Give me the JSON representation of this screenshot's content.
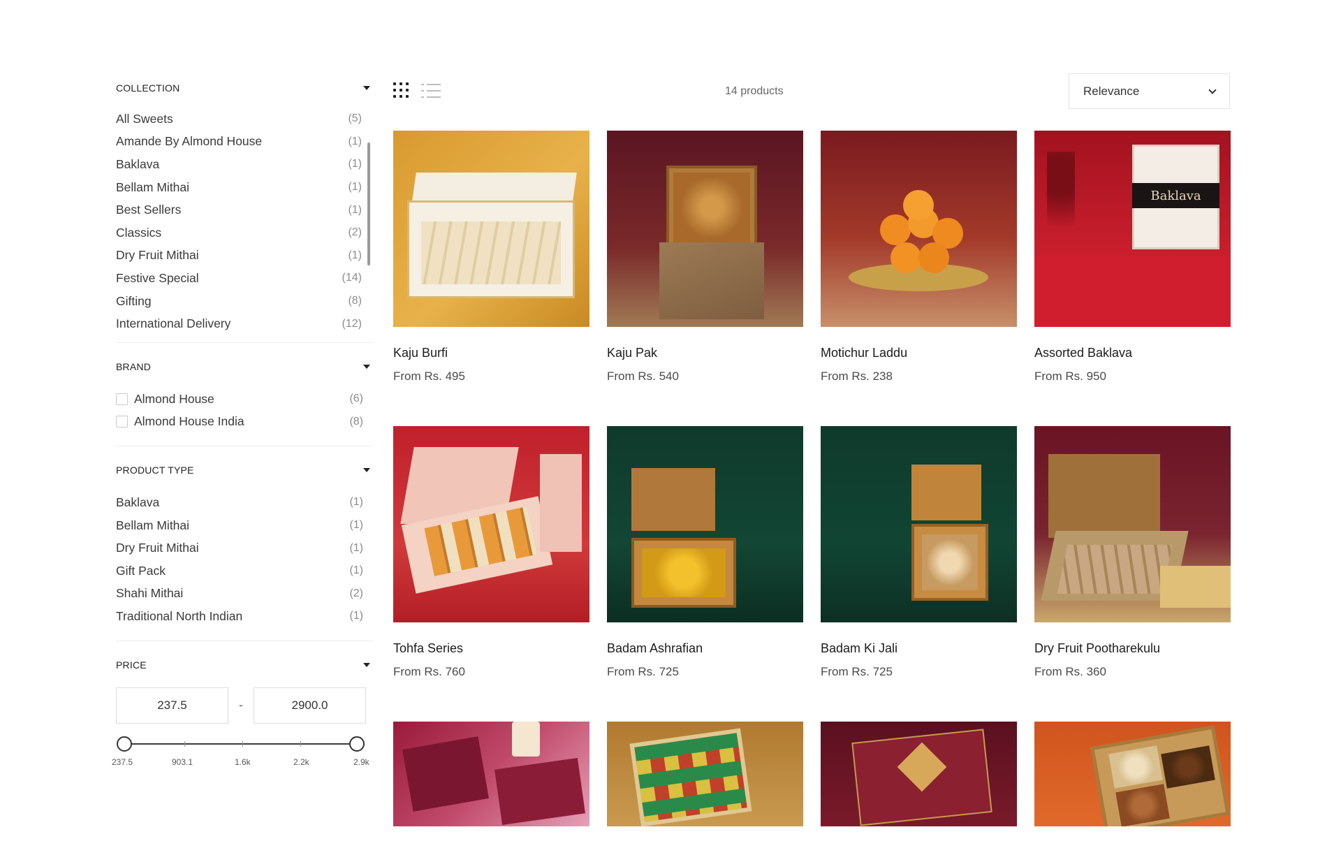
{
  "sidebar": {
    "collection": {
      "title": "COLLECTION",
      "items": [
        {
          "label": "All Sweets",
          "count": "(5)"
        },
        {
          "label": "Amande By Almond House",
          "count": "(1)"
        },
        {
          "label": "Baklava",
          "count": "(1)"
        },
        {
          "label": "Bellam Mithai",
          "count": "(1)"
        },
        {
          "label": "Best Sellers",
          "count": "(1)"
        },
        {
          "label": "Classics",
          "count": "(2)"
        },
        {
          "label": "Dry Fruit Mithai",
          "count": "(1)"
        },
        {
          "label": "Festive Special",
          "count": "(14)"
        },
        {
          "label": "Gifting",
          "count": "(8)"
        },
        {
          "label": "International Delivery",
          "count": "(12)"
        }
      ]
    },
    "brand": {
      "title": "BRAND",
      "items": [
        {
          "label": "Almond House",
          "count": "(6)"
        },
        {
          "label": "Almond House India",
          "count": "(8)"
        }
      ]
    },
    "product_type": {
      "title": "PRODUCT TYPE",
      "items": [
        {
          "label": "Baklava",
          "count": "(1)"
        },
        {
          "label": "Bellam Mithai",
          "count": "(1)"
        },
        {
          "label": "Dry Fruit Mithai",
          "count": "(1)"
        },
        {
          "label": "Gift Pack",
          "count": "(1)"
        },
        {
          "label": "Shahi Mithai",
          "count": "(2)"
        },
        {
          "label": "Traditional North Indian",
          "count": "(1)"
        }
      ]
    },
    "price": {
      "title": "PRICE",
      "min_value": "237.5",
      "max_value": "2900.0",
      "separator": "-",
      "tick_labels": [
        "237.5",
        "903.1",
        "1.6k",
        "2.2k",
        "2.9k"
      ]
    }
  },
  "toolbar": {
    "product_count": "14 products",
    "sort_value": "Relevance"
  },
  "products": [
    {
      "name": "Kaju Burfi",
      "price": "From Rs. 495"
    },
    {
      "name": "Kaju Pak",
      "price": "From Rs. 540"
    },
    {
      "name": "Motichur Laddu",
      "price": "From Rs. 238"
    },
    {
      "name": "Assorted Baklava",
      "price": "From Rs. 950"
    },
    {
      "name": "Tohfa Series",
      "price": "From Rs. 760"
    },
    {
      "name": "Badam Ashrafian",
      "price": "From Rs. 725"
    },
    {
      "name": "Badam Ki Jali",
      "price": "From Rs. 725"
    },
    {
      "name": "Dry Fruit Pootharekulu",
      "price": "From Rs. 360"
    }
  ],
  "image_text": {
    "baklava_box": "Baklava"
  },
  "colors": {
    "accent": "#222222",
    "muted": "#8c8c8c"
  }
}
